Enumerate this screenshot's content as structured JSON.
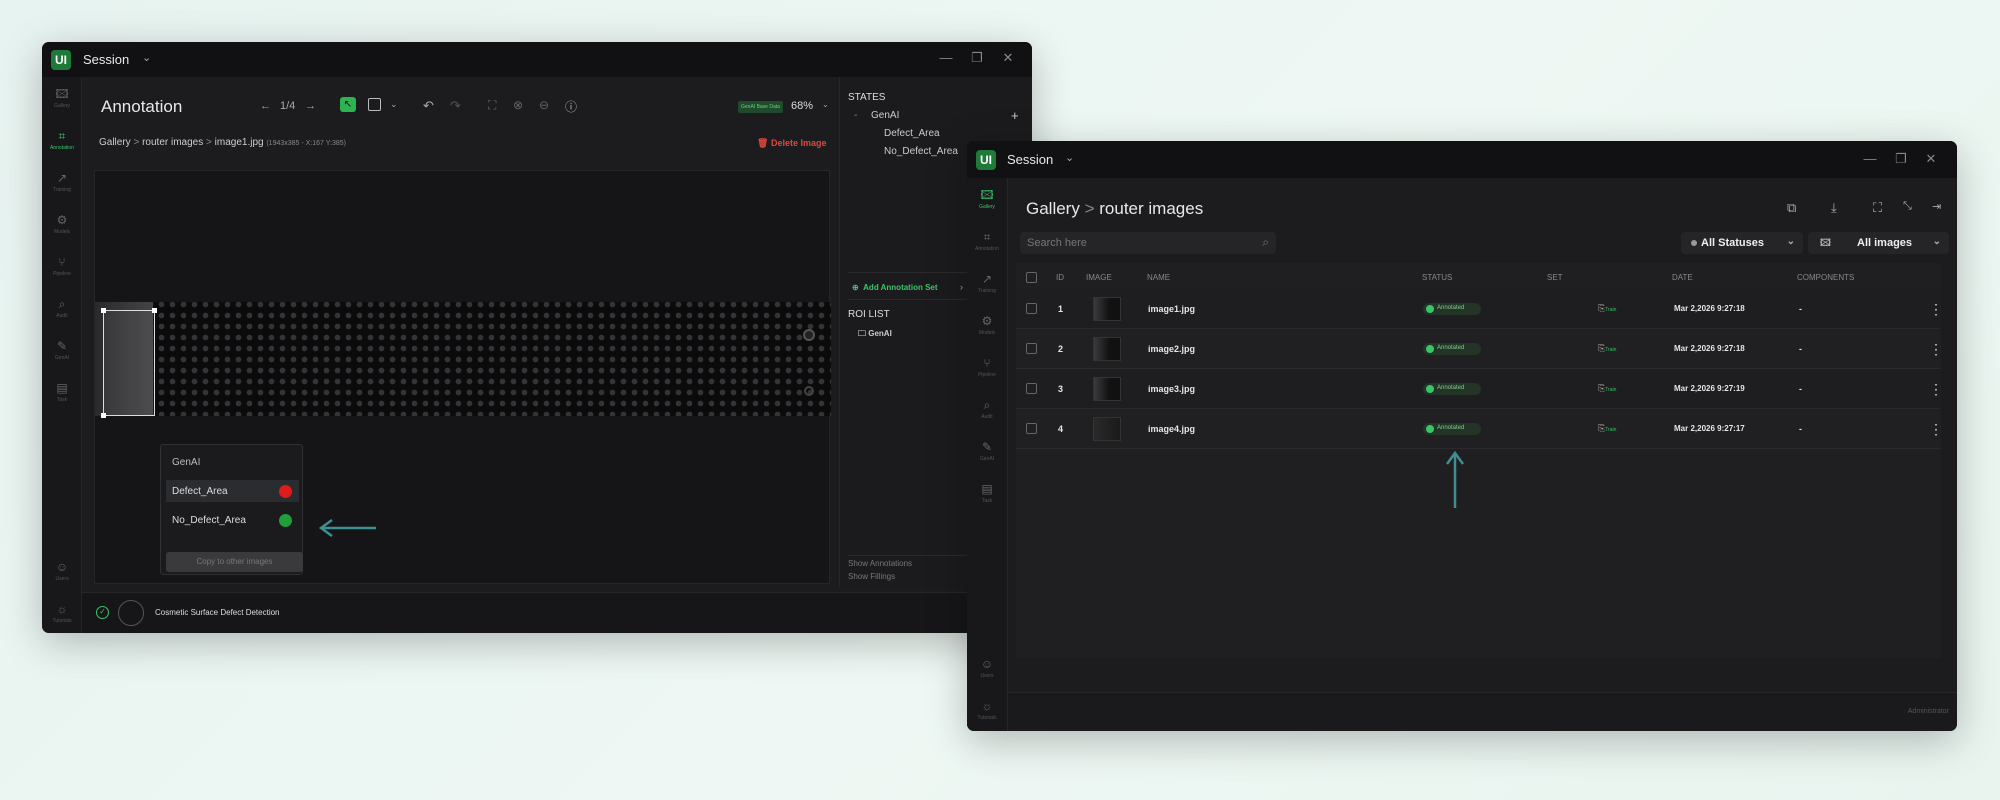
{
  "w1": {
    "title": "Session",
    "sidebar": [
      {
        "label": "Gallery",
        "icon": "image-icon"
      },
      {
        "label": "Annotation",
        "icon": "crop-icon"
      },
      {
        "label": "Training",
        "icon": "trend-icon"
      },
      {
        "label": "Models",
        "icon": "chip-icon"
      },
      {
        "label": "Pipeline",
        "icon": "pipeline-icon"
      },
      {
        "label": "Audit",
        "icon": "audit-icon"
      },
      {
        "label": "GenAI",
        "icon": "wand-icon"
      },
      {
        "label": "Task",
        "icon": "clipboard-icon"
      }
    ],
    "sidebar_bottom": [
      {
        "label": "Users"
      },
      {
        "label": "Tutorials"
      }
    ],
    "page_title": "Annotation",
    "page_counter": "1/4",
    "zoom": "68%",
    "save_badge": "GenAI Base Data",
    "breadcrumb": {
      "gallery": "Gallery",
      "sep": ">",
      "folder": "router images",
      "file": "image1.jpg",
      "meta": "(1943x385 - X:167 Y:385)"
    },
    "delete_label": "Delete Image",
    "states": {
      "header": "STATES",
      "group": "GenAI",
      "collapse": "-",
      "items": [
        {
          "name": "Defect_Area",
          "color": "#e01b1b"
        },
        {
          "name": "No_Defect_Area",
          "color": "#1f9e3a"
        }
      ],
      "add_set": "Add Annotation Set"
    },
    "roi": {
      "header": "ROI LIST",
      "item": "GenAI"
    },
    "show": {
      "annotations": "Show Annotations",
      "fillings": "Show Fillings"
    },
    "popup": {
      "header": "GenAI",
      "items": [
        {
          "name": "Defect_Area",
          "color": "#e01b1b"
        },
        {
          "name": "No_Defect_Area",
          "color": "#1f9e3a"
        }
      ],
      "copy_btn": "Copy to other images"
    },
    "status_text": "Cosmetic Surface Defect Detection"
  },
  "w2": {
    "title": "Session",
    "sidebar": [
      {
        "label": "Gallery"
      },
      {
        "label": "Annotation"
      },
      {
        "label": "Training"
      },
      {
        "label": "Models"
      },
      {
        "label": "Pipeline"
      },
      {
        "label": "Audit"
      },
      {
        "label": "GenAI"
      },
      {
        "label": "Task"
      }
    ],
    "sidebar_bottom": [
      {
        "label": "Users"
      },
      {
        "label": "Tutorials"
      }
    ],
    "breadcrumb": {
      "gallery": "Gallery",
      "sep": ">",
      "folder": "router images"
    },
    "search_placeholder": "Search here",
    "filter_status": "All Statuses",
    "filter_images": "All images",
    "columns": [
      "ID",
      "IMAGE",
      "NAME",
      "STATUS",
      "SET",
      "DATE",
      "COMPONENTS"
    ],
    "rows": [
      {
        "id": "1",
        "name": "image1.jpg",
        "status": "Annotated",
        "set": "Train",
        "date": "Mar 2,2026 9:27:18",
        "components": "-"
      },
      {
        "id": "2",
        "name": "image2.jpg",
        "status": "Annotated",
        "set": "Train",
        "date": "Mar 2,2026 9:27:18",
        "components": "-"
      },
      {
        "id": "3",
        "name": "image3.jpg",
        "status": "Annotated",
        "set": "Train",
        "date": "Mar 2,2026 9:27:19",
        "components": "-"
      },
      {
        "id": "4",
        "name": "image4.jpg",
        "status": "Annotated",
        "set": "Train",
        "date": "Mar 2,2026 9:27:17",
        "components": "-"
      }
    ],
    "footer_user": "Administrator"
  },
  "accent": "#3cc46a",
  "arrow_color": "#3e8f91"
}
